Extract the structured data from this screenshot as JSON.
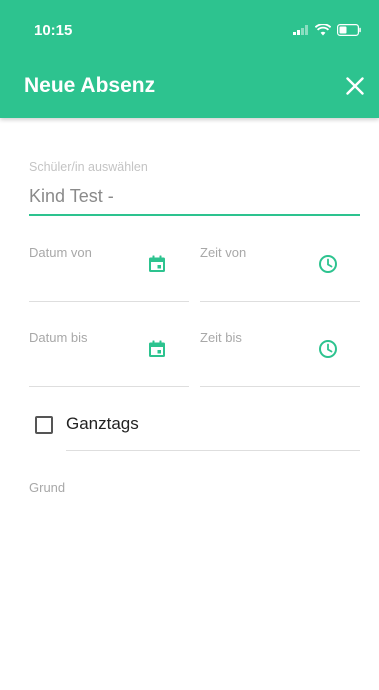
{
  "status_bar": {
    "time": "10:15"
  },
  "header": {
    "title": "Neue Absenz"
  },
  "colors": {
    "accent": "#2dc38f",
    "header_bg": "#2dc38f"
  },
  "form": {
    "student": {
      "label": "Schüler/in auswählen",
      "value": "Kind Test -"
    },
    "date_from": {
      "label": "Datum von",
      "icon": "calendar-icon"
    },
    "time_from": {
      "label": "Zeit von",
      "icon": "clock-icon"
    },
    "date_to": {
      "label": "Datum bis",
      "icon": "calendar-icon"
    },
    "time_to": {
      "label": "Zeit bis",
      "icon": "clock-icon"
    },
    "full_day": {
      "label": "Ganztags",
      "checked": false
    },
    "reason": {
      "label": "Grund"
    }
  }
}
